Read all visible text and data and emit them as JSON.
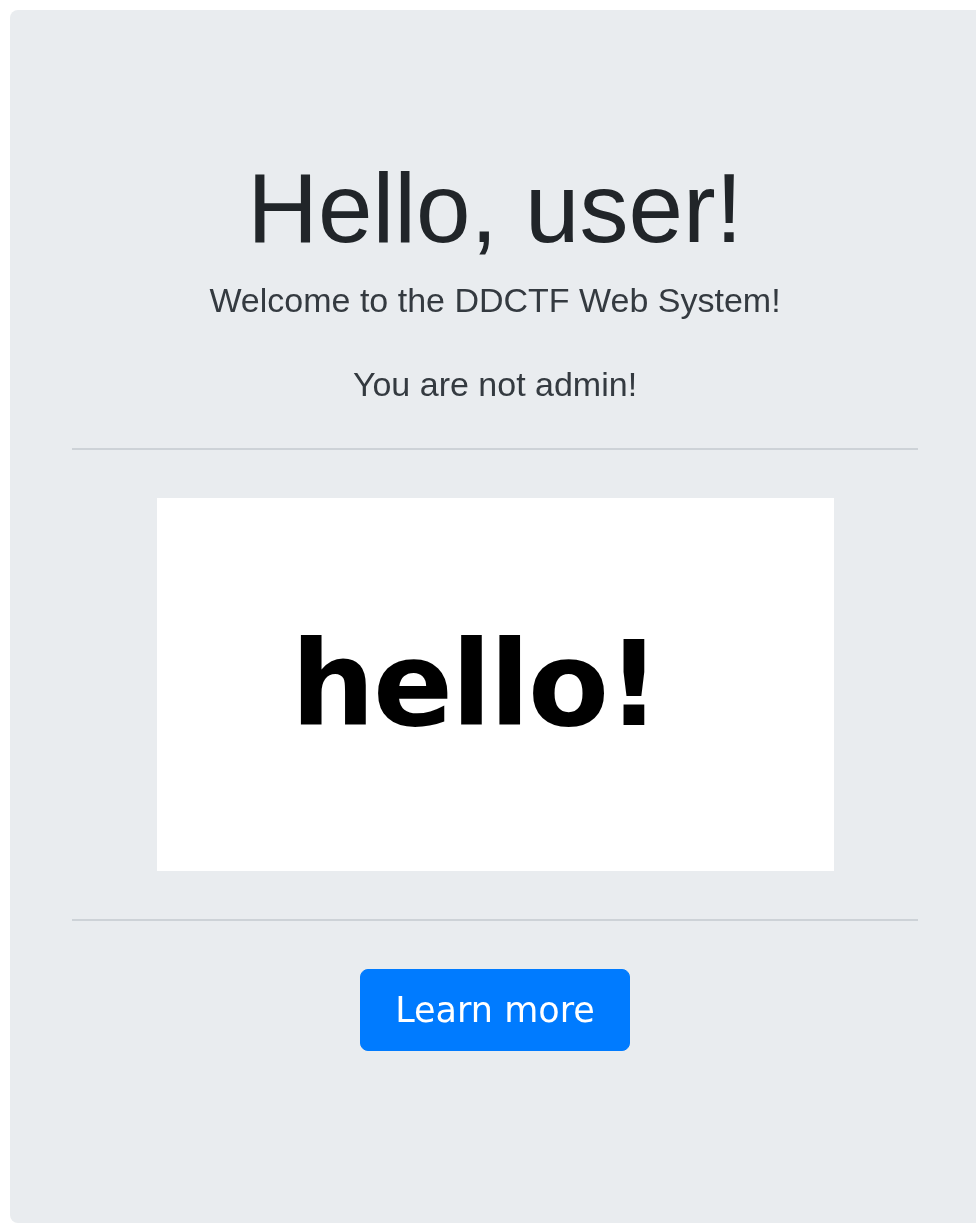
{
  "heading": "Hello, user!",
  "lead": "Welcome to the DDCTF Web System!",
  "message": "You are not admin!",
  "image": {
    "text": "hello!"
  },
  "button": {
    "label": "Learn more"
  }
}
